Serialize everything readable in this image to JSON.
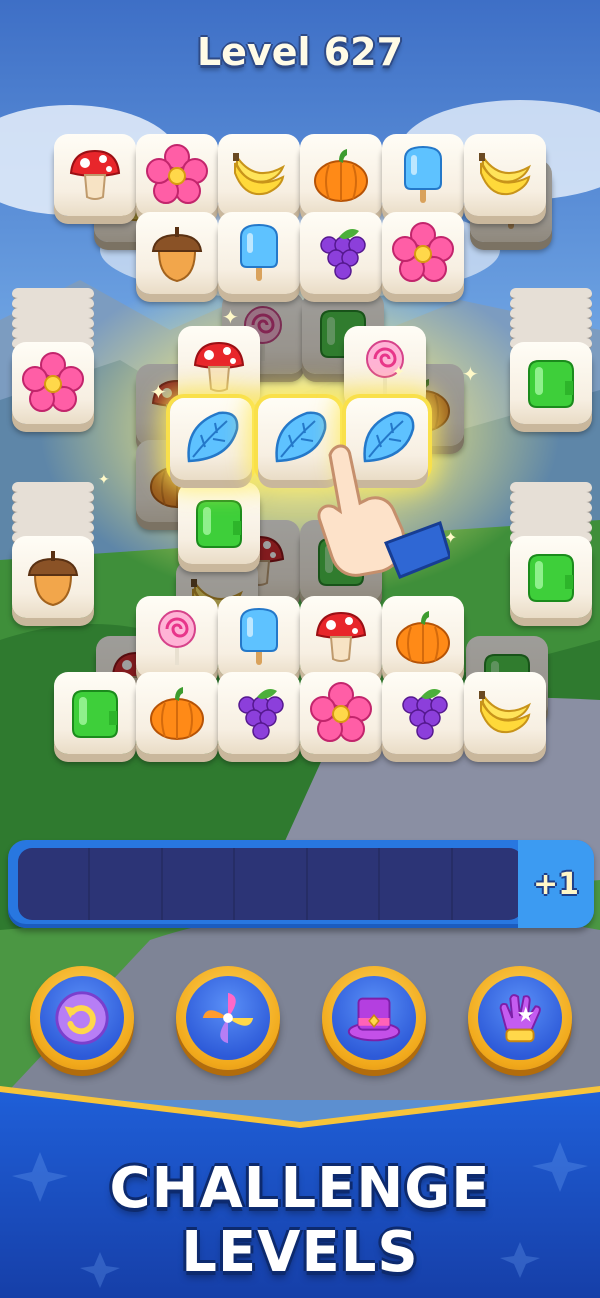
{
  "level": {
    "title": "Level 627"
  },
  "tray": {
    "slot_count": 7,
    "plus_label": "+1"
  },
  "powerups": [
    {
      "name": "undo",
      "icon": "undo-arrow-icon"
    },
    {
      "name": "shuffle",
      "icon": "pinwheel-icon"
    },
    {
      "name": "magic-hat",
      "icon": "magic-hat-icon"
    },
    {
      "name": "magic-glove",
      "icon": "magic-glove-icon"
    }
  ],
  "banner": {
    "line1": "CHALLENGE",
    "line2": "LEVELS"
  },
  "board": {
    "top_row_1": [
      "mushroom",
      "flower",
      "banana",
      "pumpkin",
      "popsicle",
      "banana"
    ],
    "top_row_2": [
      "acorn",
      "popsicle",
      "grapes",
      "flower"
    ],
    "middle_row_top": [
      "mushroom",
      "lollipop"
    ],
    "selected_row": [
      "leaf",
      "leaf",
      "leaf"
    ],
    "middle_row_bottom": [
      "jelly"
    ],
    "bottom_row_1": [
      "lollipop",
      "popsicle",
      "mushroom",
      "pumpkin"
    ],
    "bottom_row_2": [
      "jelly",
      "pumpkin",
      "grapes",
      "flower",
      "grapes",
      "banana"
    ],
    "side_stacks": {
      "left_top": "flower",
      "right_top": "jelly",
      "left_bottom": "acorn",
      "right_bottom": "jelly"
    }
  },
  "colors": {
    "accent_blue": "#2877e0",
    "tray_dark": "#2c3476",
    "gold": "#f1a91b",
    "banner_blue": "#1f5fd8"
  }
}
